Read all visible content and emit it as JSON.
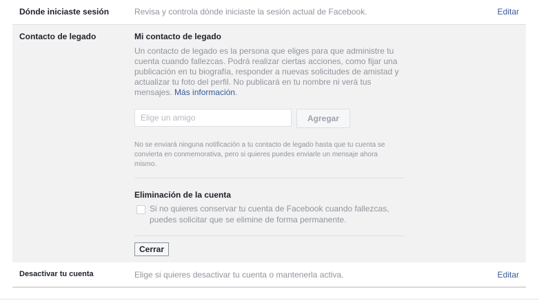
{
  "sessions_row": {
    "label": "Dónde iniciaste sesión",
    "description": "Revisa y controla dónde iniciaste la sesión actual de Facebook.",
    "edit_label": "Editar"
  },
  "legacy_section": {
    "label": "Contacto de legado",
    "title": "Mi contacto de legado",
    "description_lines": [
      "Un contacto de legado es la persona que eliges para que administre tu",
      "cuenta cuando fallezcas. Podrá realizar ciertas acciones, como fijar una",
      "publicación en tu biografía, responder a nuevas solicitudes de amistad y",
      "actualizar tu foto del perfil. No publicará en tu nombre ni verá tus",
      "mensajes."
    ],
    "more_info_link": "Más información",
    "more_info_suffix": ".",
    "friend_input_placeholder": "Elige un amigo",
    "add_button_label": "Agregar",
    "notice_lines": [
      "No se enviará ninguna notificación a tu contacto de legado hasta que tu cuenta se",
      "convierta en conmemorativa, pero si quieres puedes enviarle un mensaje ahora",
      "mismo."
    ]
  },
  "deletion_section": {
    "title": "Eliminación de la cuenta",
    "checkbox_label_lines": [
      "Si no quieres conservar tu cuenta de Facebook cuando fallezcas,",
      "puedes solicitar que se elimine de forma permanente."
    ],
    "checked": false
  },
  "close_button_label": "Cerrar",
  "deactivate_row": {
    "label": "Desactivar tu cuenta",
    "description": "Elige si quieres desactivar tu cuenta o mantenerla activa.",
    "edit_label": "Editar"
  }
}
